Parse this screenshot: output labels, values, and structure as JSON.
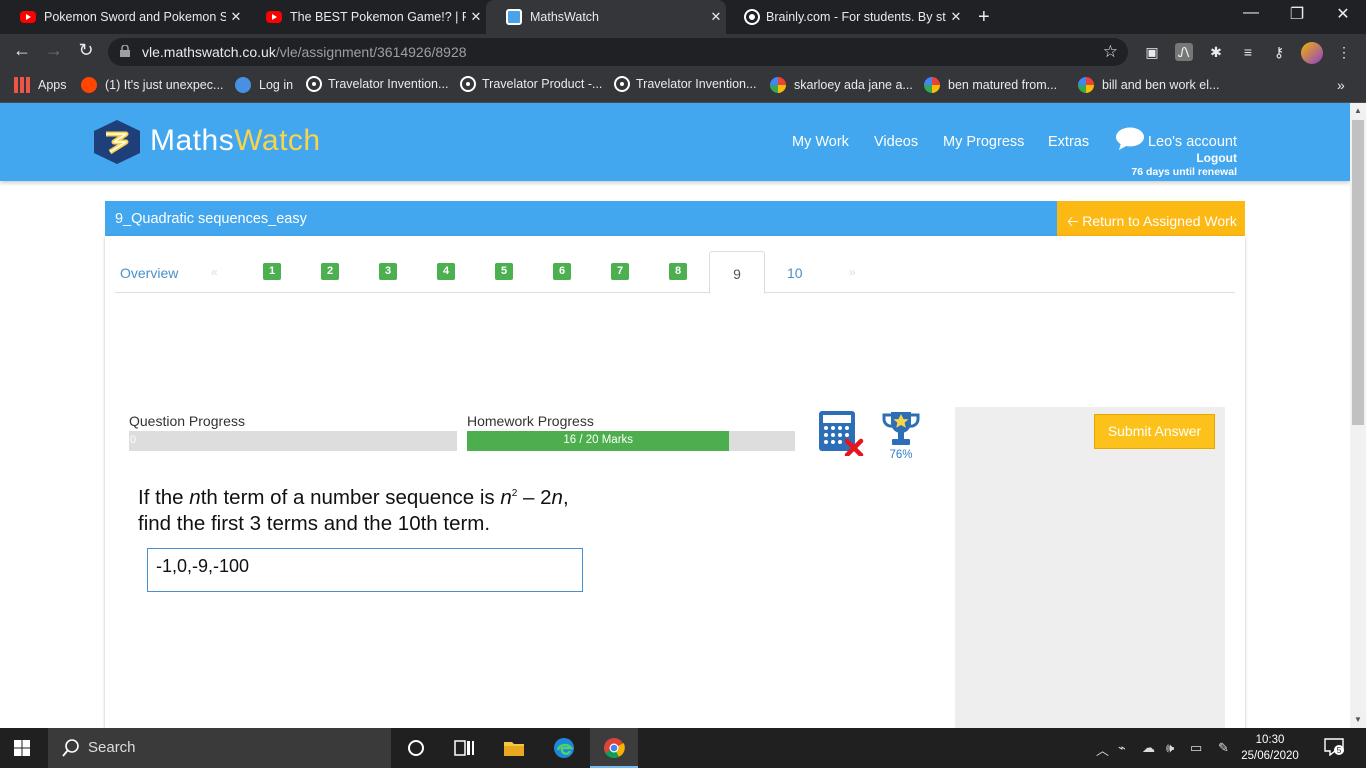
{
  "browser": {
    "tabs": [
      {
        "title": "Pokemon Sword and Pokemon Sh",
        "favicon": "youtube-icon"
      },
      {
        "title": "The BEST Pokemon Game!? | Rev",
        "favicon": "youtube-icon"
      },
      {
        "title": "MathsWatch",
        "favicon": "mathswatch-icon",
        "active": true
      },
      {
        "title": "Brainly.com - For students. By stu",
        "favicon": "brainly-icon"
      }
    ],
    "url_domain": "vle.mathswatch.co.uk",
    "url_path": "/vle/assignment/3614926/8928",
    "bookmarks": [
      {
        "label": "Apps",
        "icon": "apps-grid-icon"
      },
      {
        "label": "(1) It's just unexpec...",
        "icon": "reddit-icon"
      },
      {
        "label": "Log in",
        "icon": "chat-icon"
      },
      {
        "label": "Travelator Invention...",
        "icon": "travelator-icon"
      },
      {
        "label": "Travelator Product -...",
        "icon": "travelator-icon"
      },
      {
        "label": "Travelator Invention...",
        "icon": "travelator-icon"
      },
      {
        "label": "skarloey ada jane a...",
        "icon": "google-icon"
      },
      {
        "label": "ben matured from...",
        "icon": "google-icon"
      },
      {
        "label": "bill and ben work el...",
        "icon": "google-icon"
      }
    ],
    "more": "»"
  },
  "header": {
    "logo_maths": "Maths",
    "logo_watch": "Watch",
    "nav": [
      "My Work",
      "Videos",
      "My Progress",
      "Extras"
    ],
    "account": "Leo's account",
    "logout": "Logout",
    "renewal": "76 days until renewal"
  },
  "assignment": {
    "title": "9_Quadratic sequences_easy",
    "return_label": "Return to Assigned Work"
  },
  "tabs": {
    "overview": "Overview",
    "prev": "«",
    "next": "»",
    "completed": [
      "1",
      "2",
      "3",
      "4",
      "5",
      "6",
      "7",
      "8"
    ],
    "active": "9",
    "last": "10"
  },
  "progress": {
    "question_label": "Question Progress",
    "question_value": "0",
    "question_fraction": 0,
    "homework_label": "Homework Progress",
    "homework_text": "16 / 20 Marks",
    "homework_fraction": 0.8
  },
  "trophy_pct": "76%",
  "question": {
    "line1_a": "If the ",
    "line1_n": "n",
    "line1_b": "th term of a number sequence is ",
    "line1_n2": "n",
    "line1_sup": "2",
    "line1_c": " – 2",
    "line1_n3": "n",
    "line1_d": ",",
    "line2": "find the first 3 terms and the 10th term."
  },
  "answer_value": "-1,0,-9,-100",
  "submit_label": "Submit Answer",
  "taskbar": {
    "search": "Search",
    "time": "10:30",
    "date": "25/06/2020",
    "notifications": "5"
  },
  "colors": {
    "brand_blue": "#42a7ee",
    "accent_yellow": "#fcb813",
    "progress_green": "#4cae4c"
  }
}
